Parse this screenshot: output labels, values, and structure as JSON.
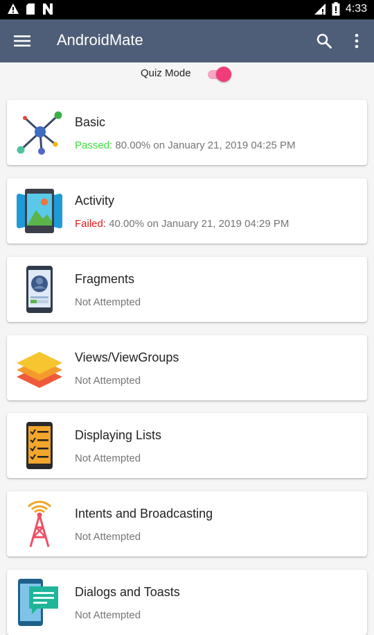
{
  "status_bar": {
    "time": "4:33",
    "left_icons": [
      "warning-icon",
      "sd-card-icon",
      "n-icon"
    ],
    "right_icons": [
      "signal-icon",
      "battery-icon"
    ]
  },
  "app_bar": {
    "title": "AndroidMate",
    "background": "#4f5e78",
    "icons": [
      "menu-icon",
      "search-icon",
      "more-vert-icon"
    ]
  },
  "quiz_mode": {
    "label": "Quiz Mode",
    "enabled": true,
    "accent": "#f13c7a"
  },
  "topics": [
    {
      "title": "Basic",
      "status_label": "Passed:",
      "status_detail": " 80.00% on January 21, 2019 04:25 PM",
      "icon": "network-nodes-icon"
    },
    {
      "title": "Activity",
      "status_label": "Failed:",
      "status_detail": " 40.00% on January 21, 2019 04:29 PM",
      "icon": "phone-screen-image-icon"
    },
    {
      "title": "Fragments",
      "status_label": "",
      "status_detail": "Not Attempted",
      "icon": "phone-profile-icon"
    },
    {
      "title": "Views/ViewGroups",
      "status_label": "",
      "status_detail": "Not Attempted",
      "icon": "layers-icon"
    },
    {
      "title": "Displaying Lists",
      "status_label": "",
      "status_detail": "Not Attempted",
      "icon": "phone-checklist-icon"
    },
    {
      "title": "Intents and Broadcasting",
      "status_label": "",
      "status_detail": "Not Attempted",
      "icon": "broadcast-tower-icon"
    },
    {
      "title": "Dialogs and Toasts",
      "status_label": "",
      "status_detail": "Not Attempted",
      "icon": "phone-dialog-icon"
    }
  ],
  "colors": {
    "passed": "#3cdc3c",
    "failed": "#e01b1b",
    "muted": "#757575"
  }
}
